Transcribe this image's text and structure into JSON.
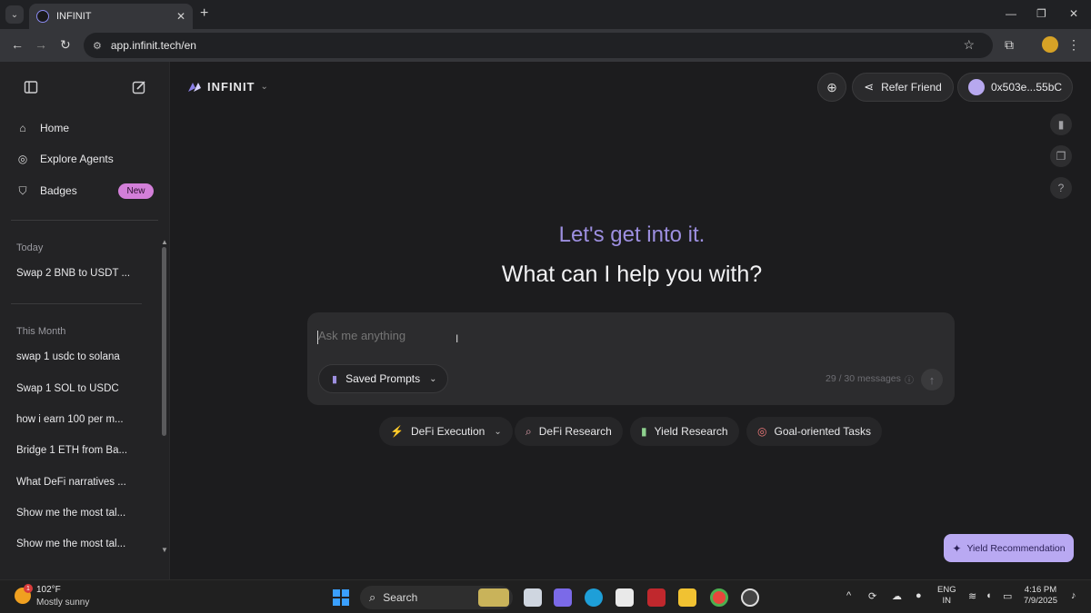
{
  "browser": {
    "tab_title": "INFINIT",
    "url": "app.infinit.tech/en",
    "new_tab": "+",
    "close_tab": "✕"
  },
  "sidebar": {
    "nav": [
      {
        "label": "Home",
        "icon": "home-icon"
      },
      {
        "label": "Explore Agents",
        "icon": "compass-icon"
      },
      {
        "label": "Badges",
        "icon": "shield-icon"
      }
    ],
    "badge_new": "New",
    "sections": [
      {
        "title": "Today",
        "items": [
          "Swap 2 BNB to USDT ..."
        ]
      },
      {
        "title": "This Month",
        "items": [
          "swap 1 usdc to solana",
          "Swap 1 SOL to USDC",
          "how i earn 100 per m...",
          "Bridge 1 ETH from Ba...",
          "What DeFi narratives ...",
          "Show me the most tal...",
          "Show me the most tal..."
        ]
      }
    ]
  },
  "header": {
    "brand": "INFINIT",
    "refer_label": "Refer Friend",
    "wallet_label": "0x503e...55bC"
  },
  "hero": {
    "line1": "Let's get into it.",
    "line2": "What can I help you with?"
  },
  "composer": {
    "placeholder": "Ask me anything",
    "saved_prompts": "Saved Prompts",
    "message_count": "29 / 30 messages"
  },
  "chips": [
    {
      "label": "DeFi Execution",
      "icon": "bolt-icon",
      "color": "#f5c542"
    },
    {
      "label": "DeFi Research",
      "icon": "search-icon",
      "color": "#e6a3b0"
    },
    {
      "label": "Yield Research",
      "icon": "bar-chart-icon",
      "color": "#8fd18f"
    },
    {
      "label": "Goal-oriented Tasks",
      "icon": "target-icon",
      "color": "#f07a7a"
    }
  ],
  "yield_button": "Yield Recommendation",
  "taskbar": {
    "temperature": "102°F",
    "weather": "Mostly sunny",
    "weather_badge": "1",
    "search": "Search",
    "lang_1": "ENG",
    "lang_2": "IN",
    "time": "4:16 PM",
    "date": "7/9/2025"
  },
  "colors": {
    "accent": "#9d8fe0",
    "badge": "#d37fd9",
    "yield": "#b9a9f2"
  }
}
